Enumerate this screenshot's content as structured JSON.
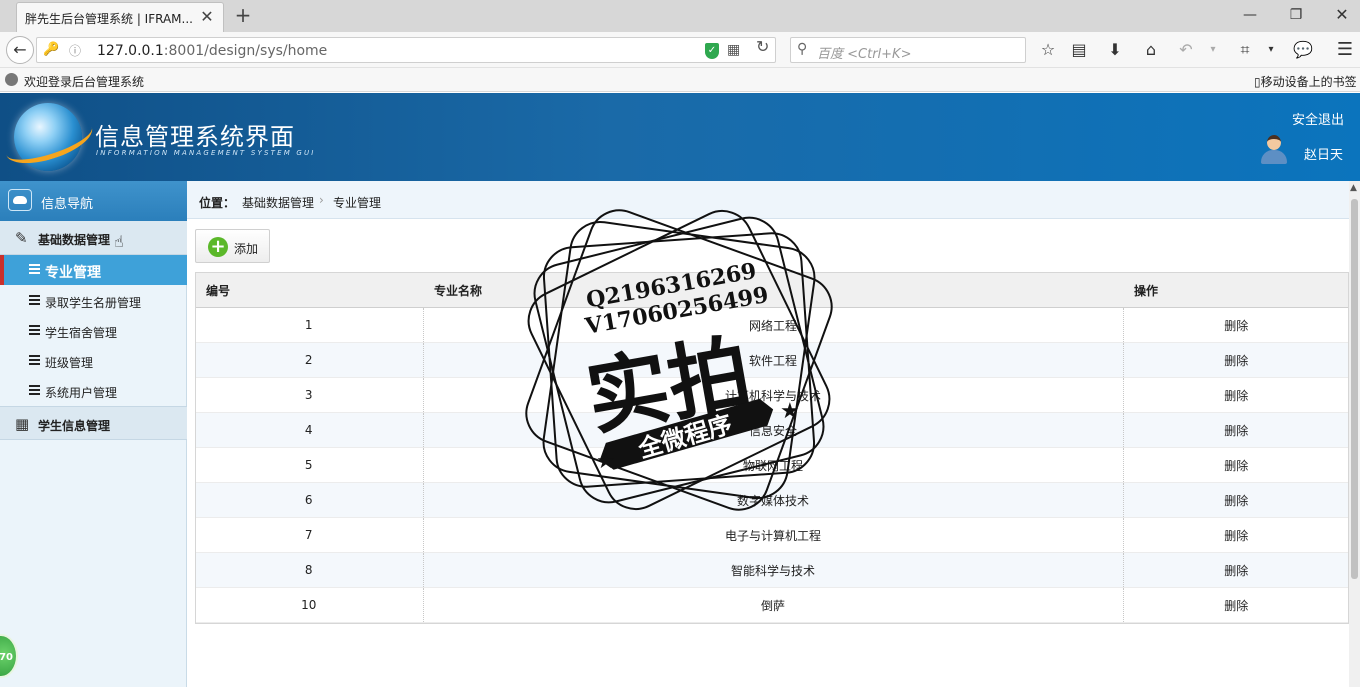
{
  "browser": {
    "tab_title": "胖先生后台管理系统 | IFRAM...",
    "tab_close": "✕",
    "new_tab": "+",
    "url_host": "127.0.0.1",
    "url_rest": ":8001/design/sys/home",
    "search_placeholder": "百度 <Ctrl+K>",
    "bookmark_text": "欢迎登录后台管理系统",
    "mobile_bookmarks": "移动设备上的书签"
  },
  "header": {
    "title": "信息管理系统界面",
    "subtitle": "INFORMATION MANAGEMENT SYSTEM GUI",
    "logout": "安全退出",
    "username": "赵日天"
  },
  "sidebar": {
    "head": "信息导航",
    "groups": [
      {
        "label": "基础数据管理",
        "items": [
          {
            "label": "专业管理",
            "active": true
          },
          {
            "label": "录取学生名册管理"
          },
          {
            "label": "学生宿舍管理"
          },
          {
            "label": "班级管理"
          },
          {
            "label": "系统用户管理"
          }
        ]
      },
      {
        "label": "学生信息管理",
        "items": []
      }
    ],
    "float_badge": "70"
  },
  "main": {
    "breadcrumb": {
      "label": "位置：",
      "items": [
        "基础数据管理",
        "专业管理"
      ],
      "sep": "›"
    },
    "add_button": "添加",
    "table": {
      "columns": [
        "编号",
        "专业名称",
        "操作"
      ],
      "rows": [
        {
          "id": "1",
          "name": "网络工程",
          "action": "删除"
        },
        {
          "id": "2",
          "name": "软件工程",
          "action": "删除"
        },
        {
          "id": "3",
          "name": "计算机科学与技术",
          "action": "删除"
        },
        {
          "id": "4",
          "name": "信息安全",
          "action": "删除"
        },
        {
          "id": "5",
          "name": "物联网工程",
          "action": "删除"
        },
        {
          "id": "6",
          "name": "数字媒体技术",
          "action": "删除"
        },
        {
          "id": "7",
          "name": "电子与计算机工程",
          "action": "删除"
        },
        {
          "id": "8",
          "name": "智能科学与技术",
          "action": "删除"
        },
        {
          "id": "10",
          "name": "倒萨",
          "action": "删除"
        }
      ]
    }
  },
  "watermark": {
    "line1": "Q2196316269",
    "line2": "V17060256499",
    "big": "实拍",
    "banner": "全微程序"
  }
}
